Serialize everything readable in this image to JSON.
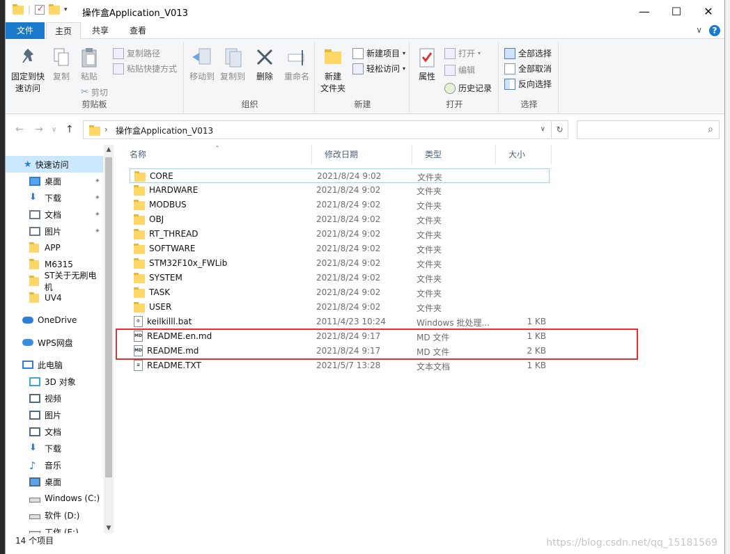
{
  "window": {
    "title": "操作盒Application_V013",
    "minimize": "—",
    "maximize": "☐",
    "close": "✕"
  },
  "ribbon_tabs": {
    "file": "文件",
    "home": "主页",
    "share": "共享",
    "view": "查看",
    "collapse": "∨",
    "help": "?"
  },
  "ribbon": {
    "clipboard": {
      "label": "剪贴板",
      "pin_l1": "固定到快",
      "pin_l2": "速访问",
      "copy": "复制",
      "paste": "粘贴",
      "copy_path": "复制路径",
      "paste_shortcut": "粘贴快捷方式",
      "cut": "剪切"
    },
    "organize": {
      "label": "组织",
      "move_to": "移动到",
      "copy_to": "复制到",
      "delete": "删除",
      "rename": "重命名"
    },
    "new": {
      "label": "新建",
      "new_folder_l1": "新建",
      "new_folder_l2": "文件夹",
      "new_item": "新建项目",
      "easy_access": "轻松访问"
    },
    "open": {
      "label": "打开",
      "properties": "属性",
      "open": "打开",
      "edit": "编辑",
      "history": "历史记录"
    },
    "select": {
      "label": "选择",
      "select_all": "全部选择",
      "select_none": "全部取消",
      "invert": "反向选择"
    }
  },
  "address": {
    "back": "←",
    "forward": "→",
    "recent": "∨",
    "up": "↑",
    "path": "操作盒Application_V013",
    "sep": "›",
    "dropdown": "∨",
    "refresh": "↻",
    "search_placeholder": "",
    "search_icon": "⌕"
  },
  "nav": {
    "quick_access": "快速访问",
    "items": [
      {
        "label": "桌面",
        "pinned": true
      },
      {
        "label": "下载",
        "pinned": true
      },
      {
        "label": "文档",
        "pinned": true
      },
      {
        "label": "图片",
        "pinned": true
      },
      {
        "label": "APP"
      },
      {
        "label": "M6315"
      },
      {
        "label": "ST关于无刷电机"
      },
      {
        "label": "UV4"
      }
    ],
    "onedrive": "OneDrive",
    "wps": "WPS网盘",
    "thispc": "此电脑",
    "pc_items": [
      "3D 对象",
      "视频",
      "图片",
      "文档",
      "下载",
      "音乐",
      "桌面",
      "Windows (C:)",
      "软件 (D:)",
      "工作 (E:)"
    ]
  },
  "columns": {
    "name": "名称",
    "date": "修改日期",
    "type": "类型",
    "size": "大小"
  },
  "files": [
    {
      "name": "CORE",
      "date": "2021/8/24 9:02",
      "type": "文件夹",
      "size": "",
      "kind": "folder"
    },
    {
      "name": "HARDWARE",
      "date": "2021/8/24 9:02",
      "type": "文件夹",
      "size": "",
      "kind": "folder"
    },
    {
      "name": "MODBUS",
      "date": "2021/8/24 9:02",
      "type": "文件夹",
      "size": "",
      "kind": "folder"
    },
    {
      "name": "OBJ",
      "date": "2021/8/24 9:02",
      "type": "文件夹",
      "size": "",
      "kind": "folder"
    },
    {
      "name": "RT_THREAD",
      "date": "2021/8/24 9:02",
      "type": "文件夹",
      "size": "",
      "kind": "folder"
    },
    {
      "name": "SOFTWARE",
      "date": "2021/8/24 9:02",
      "type": "文件夹",
      "size": "",
      "kind": "folder"
    },
    {
      "name": "STM32F10x_FWLib",
      "date": "2021/8/24 9:02",
      "type": "文件夹",
      "size": "",
      "kind": "folder"
    },
    {
      "name": "SYSTEM",
      "date": "2021/8/24 9:02",
      "type": "文件夹",
      "size": "",
      "kind": "folder"
    },
    {
      "name": "TASK",
      "date": "2021/8/24 9:02",
      "type": "文件夹",
      "size": "",
      "kind": "folder"
    },
    {
      "name": "USER",
      "date": "2021/8/24 9:02",
      "type": "文件夹",
      "size": "",
      "kind": "folder"
    },
    {
      "name": "keilkilll.bat",
      "date": "2011/4/23 10:24",
      "type": "Windows 批处理...",
      "size": "1 KB",
      "kind": "bat"
    },
    {
      "name": "README.en.md",
      "date": "2021/8/24 9:17",
      "type": "MD 文件",
      "size": "1 KB",
      "kind": "md"
    },
    {
      "name": "README.md",
      "date": "2021/8/24 9:17",
      "type": "MD 文件",
      "size": "2 KB",
      "kind": "md"
    },
    {
      "name": "README.TXT",
      "date": "2021/5/7 13:28",
      "type": "文本文档",
      "size": "1 KB",
      "kind": "txt"
    }
  ],
  "status": {
    "count": "14 个项目",
    "watermark": "https://blog.csdn.net/qq_15181569"
  },
  "colors": {
    "accent": "#1979ca",
    "folder": "#ffd766",
    "highlight_box": "#e03030",
    "selection": "#cce8ff"
  }
}
